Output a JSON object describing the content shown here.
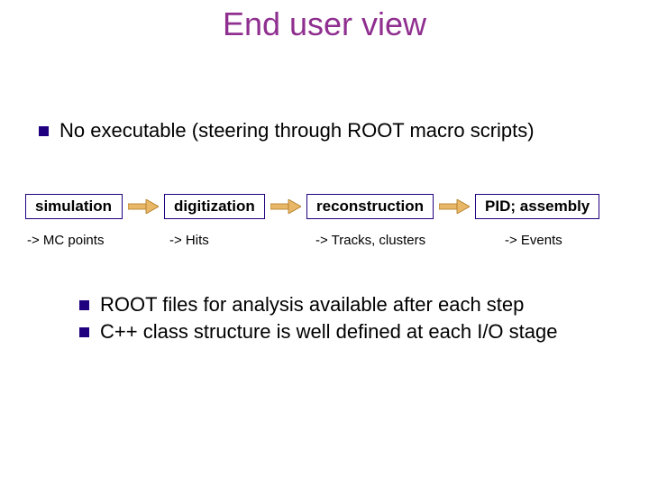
{
  "title": "End user view",
  "bullet1": "No executable (steering through ROOT macro scripts)",
  "flow": {
    "box1": "simulation",
    "box2": "digitization",
    "box3": "reconstruction",
    "box4": "PID; assembly"
  },
  "outputs": {
    "o1": "-> MC points",
    "o2": "-> Hits",
    "o3": "-> Tracks, clusters",
    "o4": "-> Events"
  },
  "bullets2": {
    "b1": "ROOT files for analysis available after each step",
    "b2": "C++ class structure is well defined at each I/O stage"
  }
}
